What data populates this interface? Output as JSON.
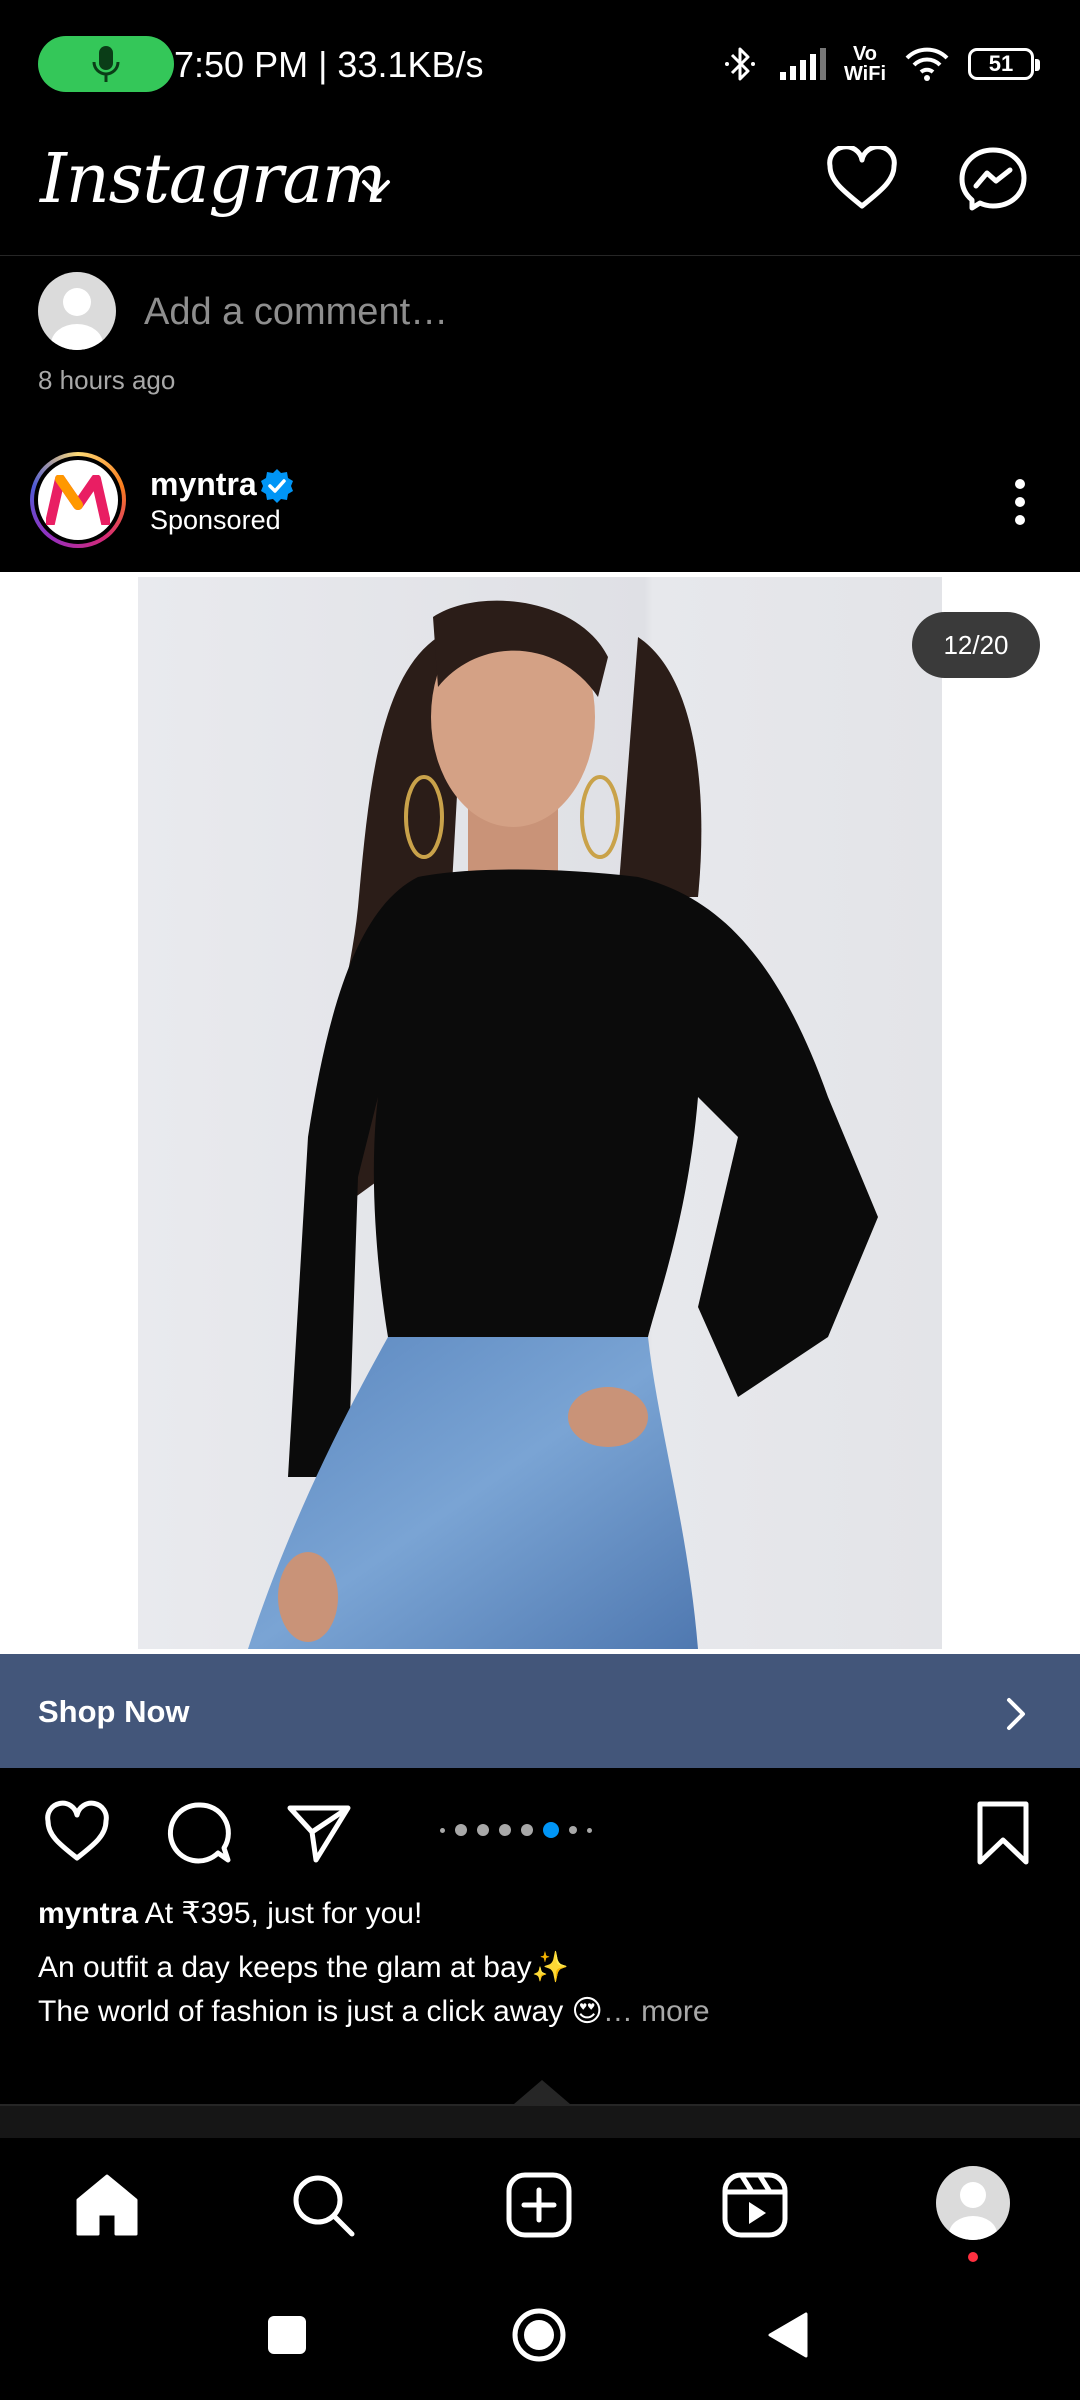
{
  "status_bar": {
    "time_speed": "7:50 PM | 33.1KB/s",
    "vowifi_top": "Vo",
    "vowifi_bottom": "WiFi",
    "battery": "51"
  },
  "header": {
    "app_name": "Instagram"
  },
  "comment": {
    "placeholder": "Add a comment…",
    "time_ago": "8 hours ago"
  },
  "post": {
    "username": "myntra",
    "sponsored": "Sponsored",
    "counter": "12/20",
    "cta": "Shop Now",
    "carousel_dots": 8,
    "carousel_active_index": 6,
    "caption": {
      "username": "myntra",
      "headline": "At ₹395, just for you!",
      "line1": "An outfit a day keeps the glam at bay✨",
      "line2": "The world of fashion is just a click away 😍",
      "more": "… more"
    }
  },
  "colors": {
    "accent": "#0095f6",
    "cta_bar": "#43567a",
    "mic_pill": "#34c759",
    "notification": "#ff3040"
  }
}
